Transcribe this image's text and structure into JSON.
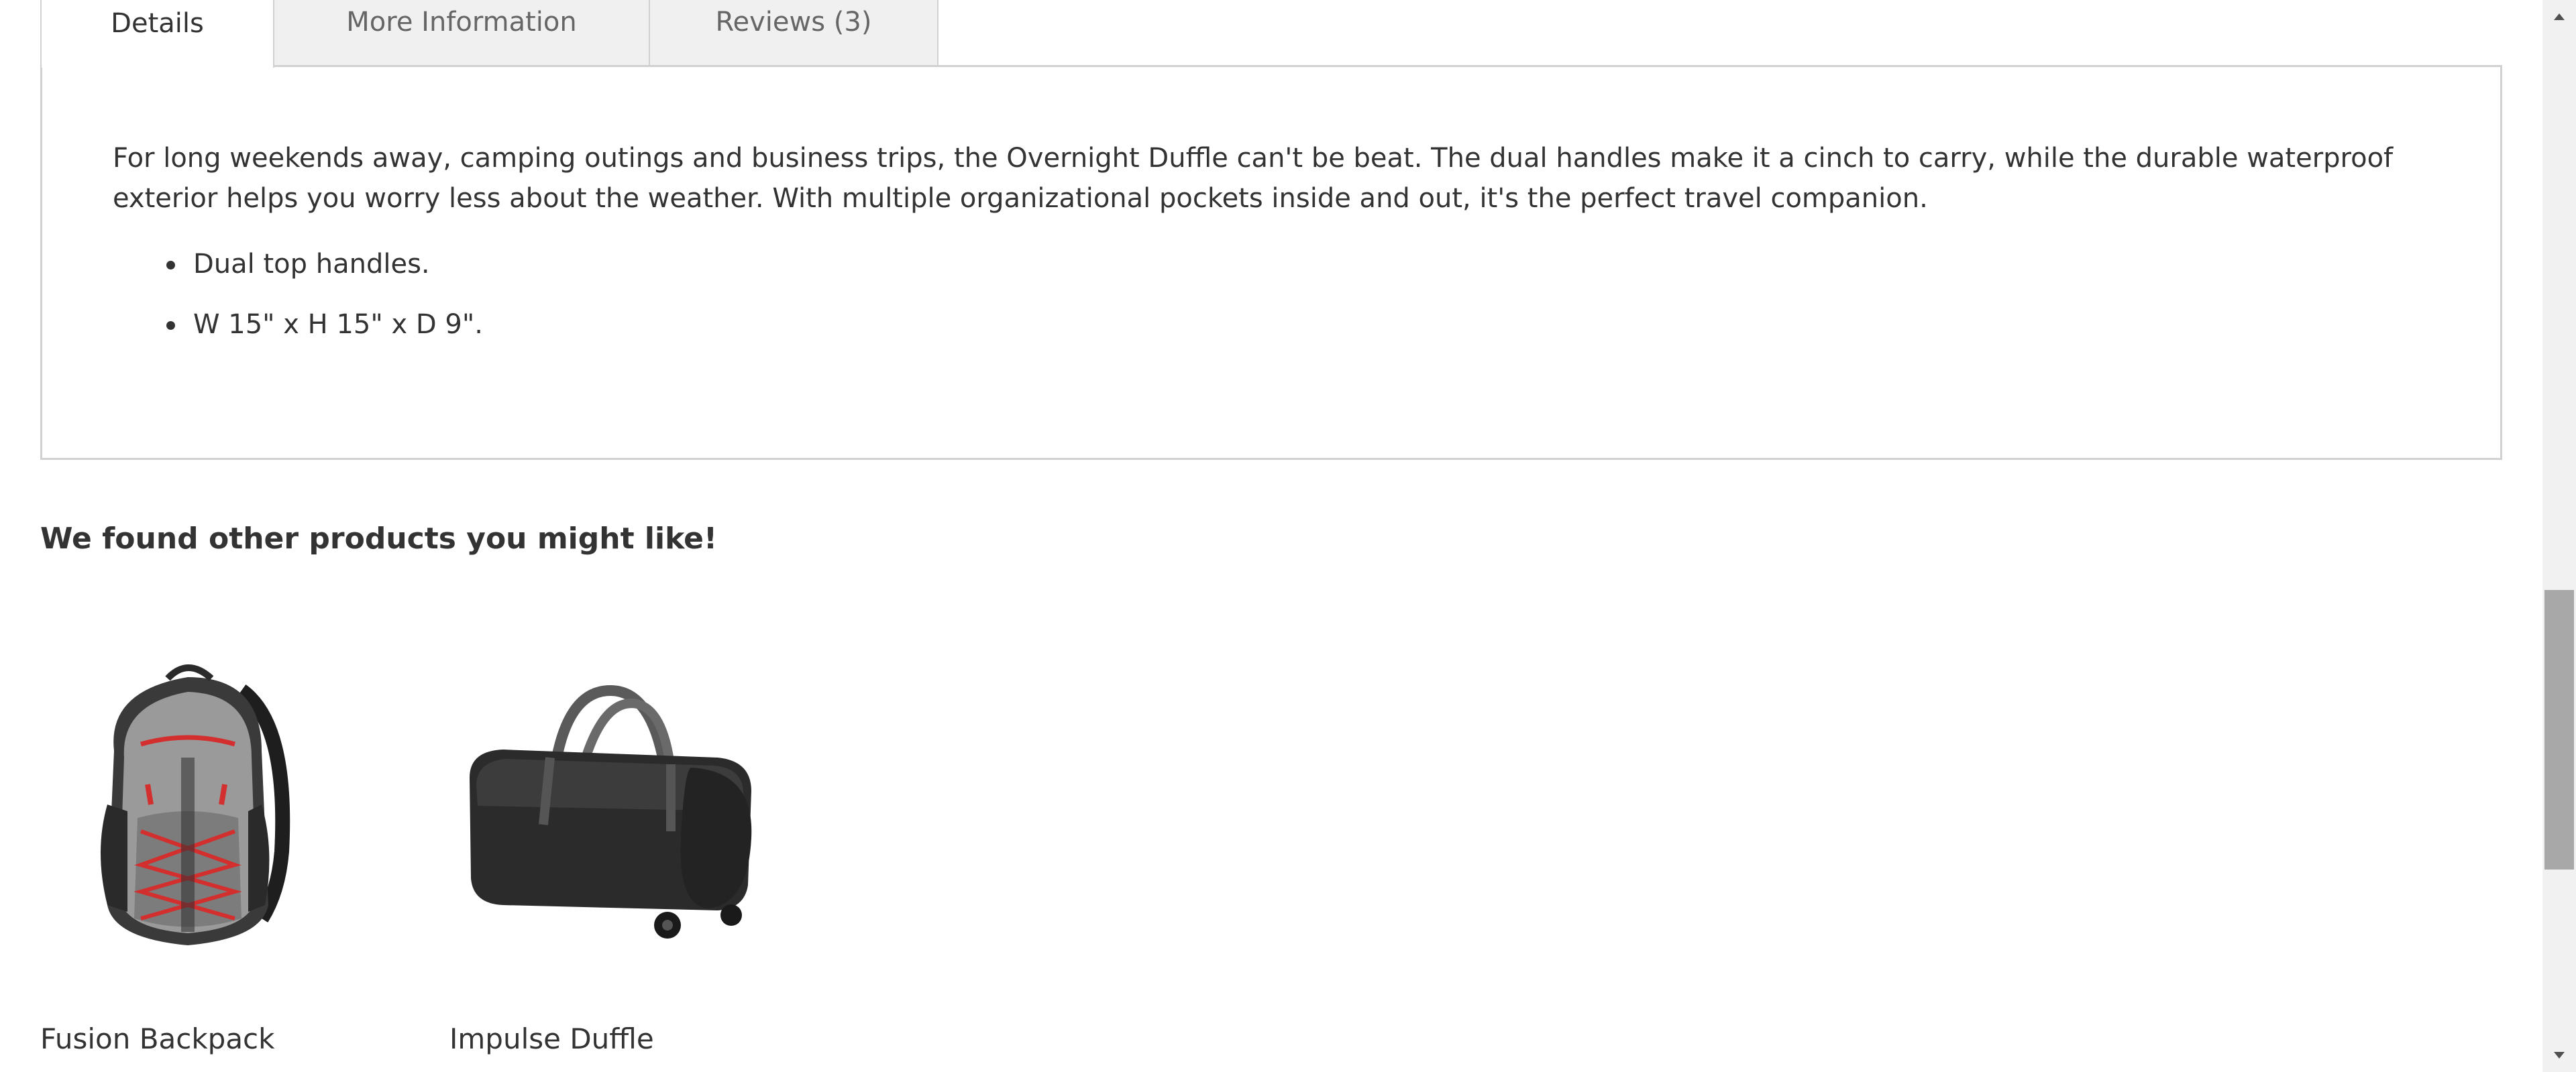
{
  "tabs": {
    "details": "Details",
    "more_information": "More Information",
    "reviews": "Reviews (3)"
  },
  "details": {
    "description": "For long weekends away, camping outings and business trips, the Overnight Duffle can't be beat. The dual handles make it a cinch to carry, while the durable waterproof exterior helps you worry less about the weather. With multiple organizational pockets inside and out, it's the perfect travel companion.",
    "features": [
      "Dual top handles.",
      "W 15\" x H 15\" x D 9\"."
    ]
  },
  "related": {
    "title": "We found other products you might like!",
    "products": [
      {
        "name": "Fusion Backpack",
        "image_icon": "backpack-image"
      },
      {
        "name": "Impulse Duffle",
        "image_icon": "duffle-bag-image"
      }
    ]
  },
  "scrollbar": {
    "scroll_fraction": 0.63
  },
  "colors": {
    "text": "#333333",
    "tab_inactive_bg": "#f0f0f0",
    "border": "#d1d1d1",
    "backpack_gray": "#9a9a9a",
    "backpack_red": "#d32f2f",
    "duffle_black": "#2b2b2b"
  }
}
